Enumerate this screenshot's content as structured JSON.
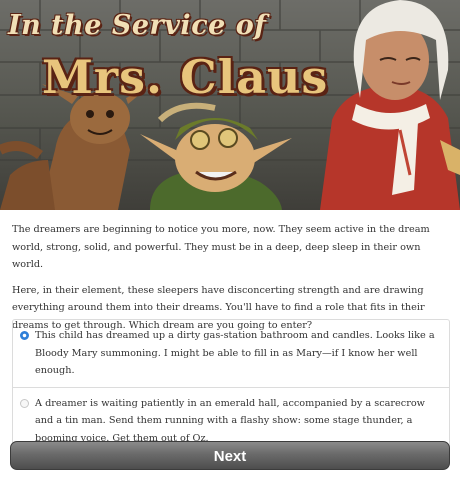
{
  "banner": {
    "title_line1": "In the Service of",
    "title_line2": "Mrs. Claus"
  },
  "story": {
    "paragraphs": [
      "The dreamers are beginning to notice you more, now. They seem active in the dream world, strong, solid, and powerful. They must be in a deep, deep sleep in their own world.",
      "Here, in their element, these sleepers have disconcerting strength and are drawing everything around them into their dreams. You'll have to find a role that fits in their dreams to get through. Which dream are you going to enter?"
    ]
  },
  "choices": [
    {
      "text": "This child has dreamed up a dirty gas-station bathroom and candles. Looks like a Bloody Mary summoning. I might be able to fill in as Mary—if I know her well enough.",
      "selected": true
    },
    {
      "text": "A dreamer is waiting patiently in an emerald hall, accompanied by a scarecrow and a tin man. Send them running with a flashy show: some stage thunder, a booming voice. Get them out of Oz.",
      "selected": false
    }
  ],
  "next_button": {
    "label": "Next"
  },
  "colors": {
    "accent_radio": "#2f7fd8",
    "button_dark": "#4d4d4d",
    "title_gold": "#e8c57d",
    "coat_red": "#b6362a"
  }
}
